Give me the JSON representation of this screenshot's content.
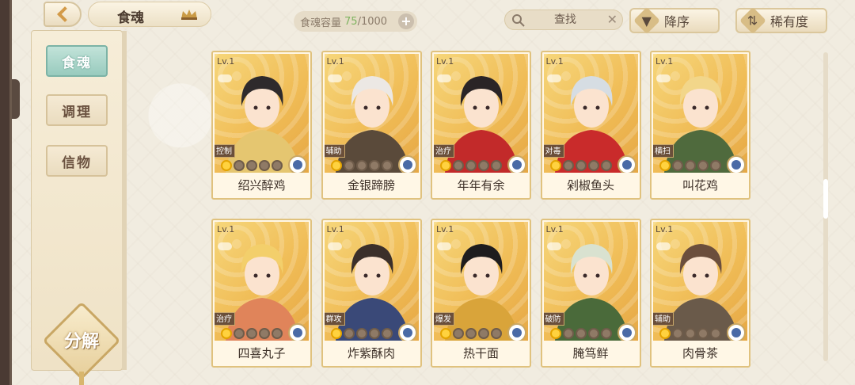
{
  "header": {
    "title": "食魂",
    "capacity_label": "食魂容量",
    "capacity_current": "75",
    "capacity_max": "/1000",
    "search_placeholder": "查找",
    "sort_order": "降序",
    "sort_field": "稀有度"
  },
  "sidebar": {
    "tabs": [
      {
        "label": "食魂",
        "active": true
      },
      {
        "label": "调理",
        "active": false
      },
      {
        "label": "信物",
        "active": false
      }
    ],
    "decompose_label": "分解"
  },
  "cards": [
    {
      "level": "Lv.1",
      "role": "控制",
      "name": "绍兴醉鸡",
      "stars": 1,
      "hair": "#2e2a2c",
      "outfit": "#e5c670"
    },
    {
      "level": "Lv.1",
      "role": "辅助",
      "name": "金银蹄膀",
      "stars": 1,
      "hair": "#ece8e4",
      "outfit": "#5a4a3a"
    },
    {
      "level": "Lv.1",
      "role": "治疗",
      "name": "年年有余",
      "stars": 1,
      "hair": "#2a2426",
      "outfit": "#c22a2a"
    },
    {
      "level": "Lv.1",
      "role": "对毒",
      "name": "剁椒鱼头",
      "stars": 1,
      "hair": "#d6dde3",
      "outfit": "#c92b2b"
    },
    {
      "level": "Lv.1",
      "role": "横扫",
      "name": "叫花鸡",
      "stars": 1,
      "hair": "#f2d68a",
      "outfit": "#4f6a3d"
    },
    {
      "level": "Lv.1",
      "role": "治疗",
      "name": "四喜丸子",
      "stars": 1,
      "hair": "#f3cf6b",
      "outfit": "#e0845a"
    },
    {
      "level": "Lv.1",
      "role": "群攻",
      "name": "炸紫酥肉",
      "stars": 1,
      "hair": "#3b2f2a",
      "outfit": "#3a4978"
    },
    {
      "level": "Lv.1",
      "role": "爆发",
      "name": "热干面",
      "stars": 1,
      "hair": "#1e1c1e",
      "outfit": "#d9a43a"
    },
    {
      "level": "Lv.1",
      "role": "破防",
      "name": "腌笃鲜",
      "stars": 1,
      "hair": "#d9e2d0",
      "outfit": "#4a6a3a"
    },
    {
      "level": "Lv.1",
      "role": "辅助",
      "name": "肉骨茶",
      "stars": 1,
      "hair": "#6b4e3c",
      "outfit": "#6a5a4a"
    }
  ]
}
